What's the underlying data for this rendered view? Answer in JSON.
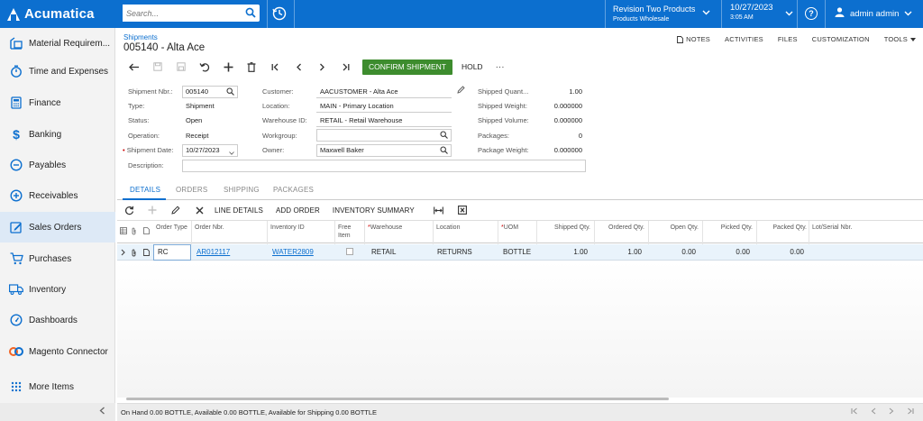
{
  "topbar": {
    "brand": "Acumatica",
    "search_placeholder": "Search...",
    "company_name": "Revision Two Products",
    "company_branch": "Products Wholesale",
    "date": "10/27/2023",
    "time": "3:05 AM",
    "user": "admin admin"
  },
  "sidebar": {
    "items": [
      {
        "label": "Material Requirem...",
        "icon": "material-requirements-icon"
      },
      {
        "label": "Time and Expenses",
        "icon": "stopwatch-icon"
      },
      {
        "label": "Finance",
        "icon": "calculator-icon"
      },
      {
        "label": "Banking",
        "icon": "dollar-icon"
      },
      {
        "label": "Payables",
        "icon": "minus-circle-icon"
      },
      {
        "label": "Receivables",
        "icon": "plus-circle-icon"
      },
      {
        "label": "Sales Orders",
        "icon": "edit-icon"
      },
      {
        "label": "Purchases",
        "icon": "cart-icon"
      },
      {
        "label": "Inventory",
        "icon": "truck-icon"
      },
      {
        "label": "Dashboards",
        "icon": "gauge-icon"
      },
      {
        "label": "Magento Connector",
        "icon": "magento-icon"
      },
      {
        "label": "More Items",
        "icon": "grid-dots-icon"
      }
    ],
    "active": "Sales Orders"
  },
  "page": {
    "breadcrumb": "Shipments",
    "title": "005140 - Alta Ace",
    "links": [
      "NOTES",
      "ACTIVITIES",
      "FILES",
      "CUSTOMIZATION",
      "TOOLS"
    ]
  },
  "toolbar": {
    "confirm_label": "CONFIRM SHIPMENT",
    "hold_label": "HOLD",
    "more_label": "···"
  },
  "form": {
    "shipment_nbr_label": "Shipment Nbr.:",
    "shipment_nbr": "005140",
    "type_label": "Type:",
    "type": "Shipment",
    "status_label": "Status:",
    "status": "Open",
    "operation_label": "Operation:",
    "operation": "Receipt",
    "shipment_date_label": "Shipment Date:",
    "shipment_date": "10/27/2023",
    "description_label": "Description:",
    "description": "",
    "customer_label": "Customer:",
    "customer": "AACUSTOMER - Alta Ace",
    "location_label": "Location:",
    "location": "MAIN - Primary Location",
    "warehouse_label": "Warehouse ID:",
    "warehouse": "RETAIL - Retail Warehouse",
    "workgroup_label": "Workgroup:",
    "workgroup": "",
    "owner_label": "Owner:",
    "owner": "Maxwell Baker",
    "shipped_qty_label": "Shipped Quant...",
    "shipped_qty": "1.00",
    "shipped_weight_label": "Shipped Weight:",
    "shipped_weight": "0.000000",
    "shipped_volume_label": "Shipped Volume:",
    "shipped_volume": "0.000000",
    "packages_label": "Packages:",
    "packages": "0",
    "package_weight_label": "Package Weight:",
    "package_weight": "0.000000"
  },
  "tabs": [
    "DETAILS",
    "ORDERS",
    "SHIPPING",
    "PACKAGES"
  ],
  "active_tab": "DETAILS",
  "grid_toolbar": [
    "LINE DETAILS",
    "ADD ORDER",
    "INVENTORY SUMMARY"
  ],
  "grid": {
    "headers": {
      "order_type": "Order Type",
      "order_nbr": "Order Nbr.",
      "inventory_id": "Inventory ID",
      "free_item": "Free Item",
      "warehouse": "Warehouse",
      "location": "Location",
      "uom": "UOM",
      "shipped_qty": "Shipped Qty.",
      "ordered_qty": "Ordered Qty.",
      "open_qty": "Open Qty.",
      "picked_qty": "Picked Qty.",
      "packed_qty": "Packed Qty.",
      "lot_serial": "Lot/Serial Nbr."
    },
    "rows": [
      {
        "order_type": "RC",
        "order_nbr": "AR012117",
        "inventory_id": "WATER2809",
        "free_item": false,
        "warehouse": "RETAIL",
        "location": "RETURNS",
        "uom": "BOTTLE",
        "shipped_qty": "1.00",
        "ordered_qty": "1.00",
        "open_qty": "0.00",
        "picked_qty": "0.00",
        "packed_qty": "0.00",
        "lot_serial": ""
      }
    ]
  },
  "status_bar": "On Hand 0.00 BOTTLE, Available 0.00 BOTTLE, Available for Shipping 0.00 BOTTLE"
}
